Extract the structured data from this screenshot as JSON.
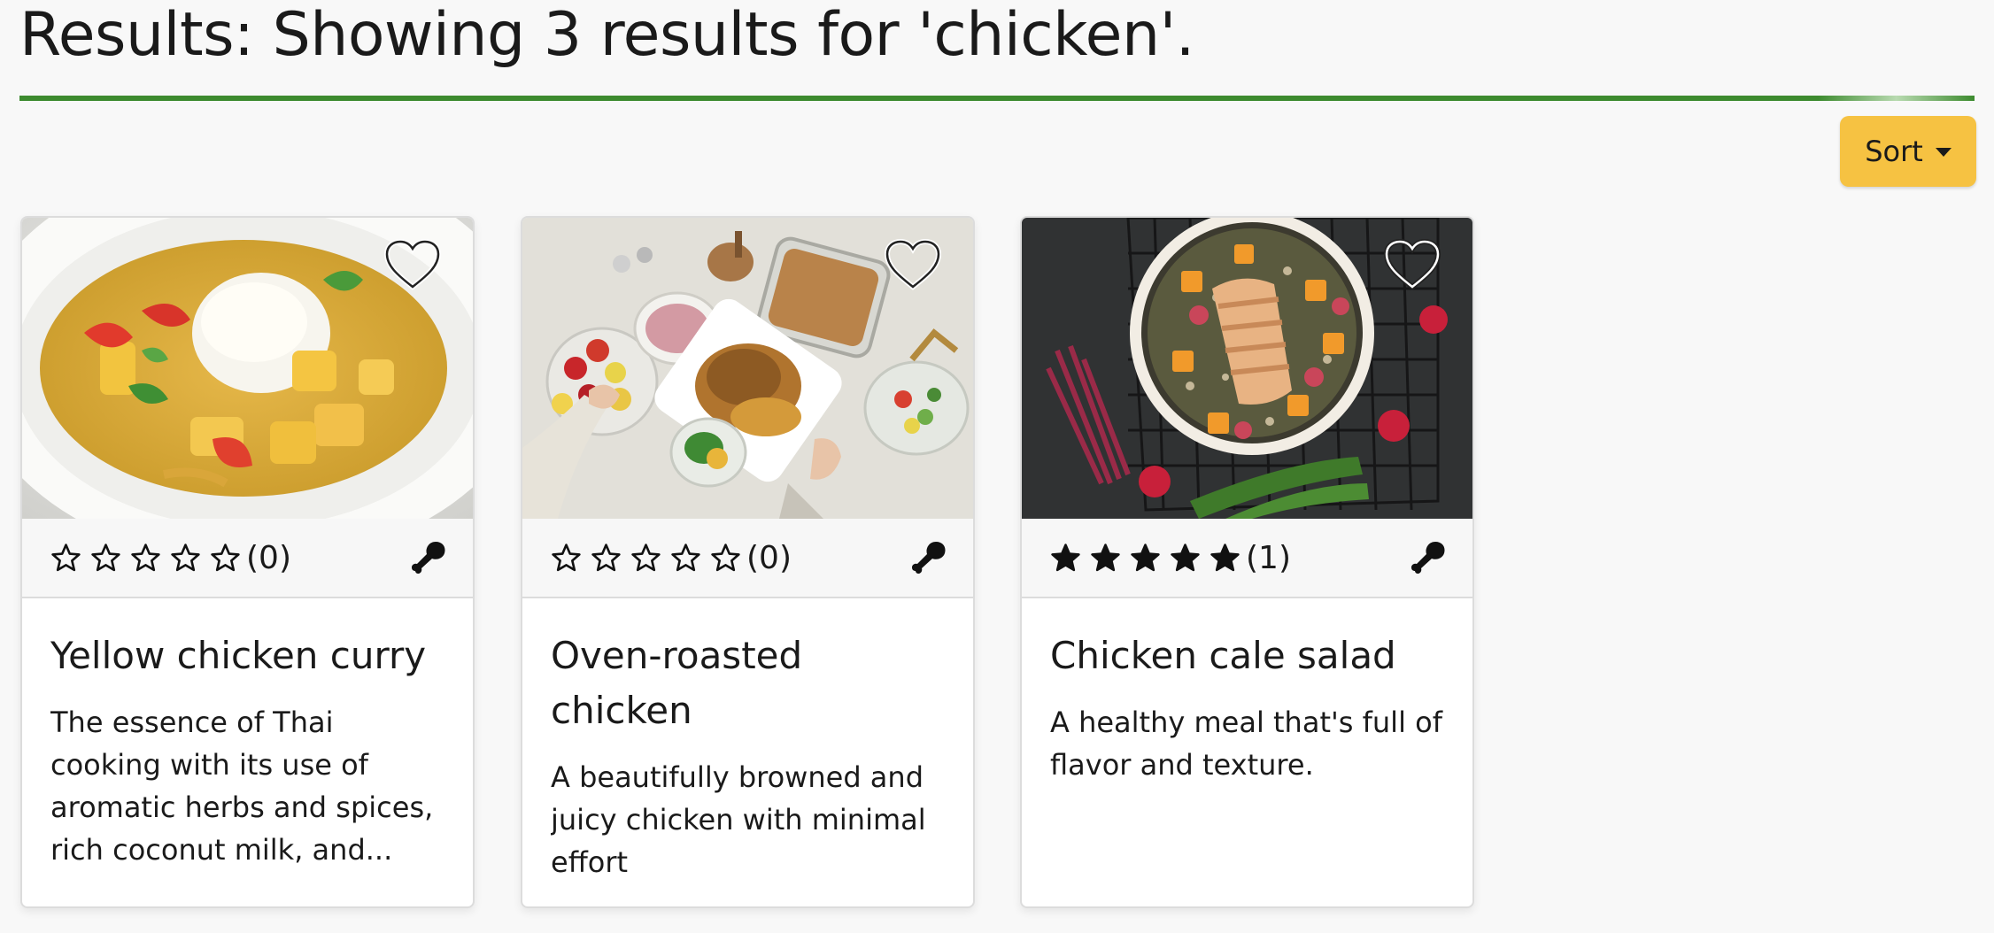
{
  "header": {
    "title": "Results: Showing 3 results for 'chicken'."
  },
  "toolbar": {
    "sort_label": "Sort"
  },
  "colors": {
    "accent_green": "#3d8b2f",
    "sort_button": "#f6c242"
  },
  "recipes": [
    {
      "title": "Yellow chicken curry",
      "description": "The essence of Thai cooking with its use of aromatic herbs and spices, rich coconut milk, and...",
      "rating": 0,
      "rating_count": "(0)",
      "favorite_icon": "heart-outline-icon",
      "category_icon": "chicken-leg-icon"
    },
    {
      "title": "Oven-roasted chicken",
      "description": "A beautifully browned and juicy chicken with minimal effort",
      "rating": 0,
      "rating_count": "(0)",
      "favorite_icon": "heart-outline-icon",
      "category_icon": "chicken-leg-icon"
    },
    {
      "title": "Chicken cale salad",
      "description": "A healthy meal that's full of flavor and texture.",
      "rating": 5,
      "rating_count": "(1)",
      "favorite_icon": "heart-outline-icon",
      "category_icon": "chicken-leg-icon"
    }
  ]
}
